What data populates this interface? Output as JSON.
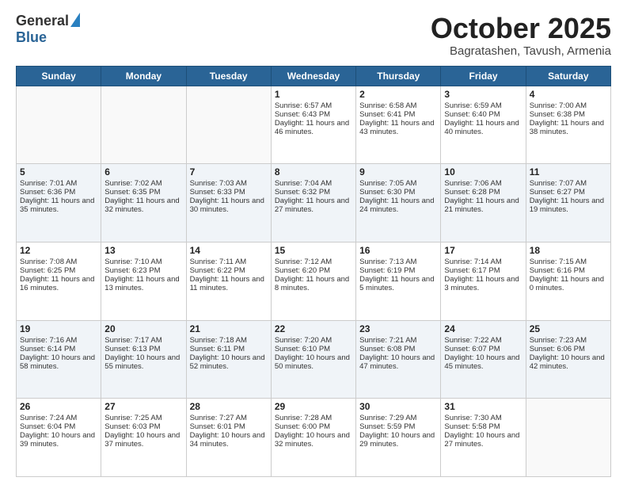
{
  "header": {
    "logo_general": "General",
    "logo_blue": "Blue",
    "month_title": "October 2025",
    "subtitle": "Bagratashen, Tavush, Armenia"
  },
  "days_of_week": [
    "Sunday",
    "Monday",
    "Tuesday",
    "Wednesday",
    "Thursday",
    "Friday",
    "Saturday"
  ],
  "weeks": [
    [
      {
        "day": "",
        "info": ""
      },
      {
        "day": "",
        "info": ""
      },
      {
        "day": "",
        "info": ""
      },
      {
        "day": "1",
        "info": "Sunrise: 6:57 AM\nSunset: 6:43 PM\nDaylight: 11 hours and 46 minutes."
      },
      {
        "day": "2",
        "info": "Sunrise: 6:58 AM\nSunset: 6:41 PM\nDaylight: 11 hours and 43 minutes."
      },
      {
        "day": "3",
        "info": "Sunrise: 6:59 AM\nSunset: 6:40 PM\nDaylight: 11 hours and 40 minutes."
      },
      {
        "day": "4",
        "info": "Sunrise: 7:00 AM\nSunset: 6:38 PM\nDaylight: 11 hours and 38 minutes."
      }
    ],
    [
      {
        "day": "5",
        "info": "Sunrise: 7:01 AM\nSunset: 6:36 PM\nDaylight: 11 hours and 35 minutes."
      },
      {
        "day": "6",
        "info": "Sunrise: 7:02 AM\nSunset: 6:35 PM\nDaylight: 11 hours and 32 minutes."
      },
      {
        "day": "7",
        "info": "Sunrise: 7:03 AM\nSunset: 6:33 PM\nDaylight: 11 hours and 30 minutes."
      },
      {
        "day": "8",
        "info": "Sunrise: 7:04 AM\nSunset: 6:32 PM\nDaylight: 11 hours and 27 minutes."
      },
      {
        "day": "9",
        "info": "Sunrise: 7:05 AM\nSunset: 6:30 PM\nDaylight: 11 hours and 24 minutes."
      },
      {
        "day": "10",
        "info": "Sunrise: 7:06 AM\nSunset: 6:28 PM\nDaylight: 11 hours and 21 minutes."
      },
      {
        "day": "11",
        "info": "Sunrise: 7:07 AM\nSunset: 6:27 PM\nDaylight: 11 hours and 19 minutes."
      }
    ],
    [
      {
        "day": "12",
        "info": "Sunrise: 7:08 AM\nSunset: 6:25 PM\nDaylight: 11 hours and 16 minutes."
      },
      {
        "day": "13",
        "info": "Sunrise: 7:10 AM\nSunset: 6:23 PM\nDaylight: 11 hours and 13 minutes."
      },
      {
        "day": "14",
        "info": "Sunrise: 7:11 AM\nSunset: 6:22 PM\nDaylight: 11 hours and 11 minutes."
      },
      {
        "day": "15",
        "info": "Sunrise: 7:12 AM\nSunset: 6:20 PM\nDaylight: 11 hours and 8 minutes."
      },
      {
        "day": "16",
        "info": "Sunrise: 7:13 AM\nSunset: 6:19 PM\nDaylight: 11 hours and 5 minutes."
      },
      {
        "day": "17",
        "info": "Sunrise: 7:14 AM\nSunset: 6:17 PM\nDaylight: 11 hours and 3 minutes."
      },
      {
        "day": "18",
        "info": "Sunrise: 7:15 AM\nSunset: 6:16 PM\nDaylight: 11 hours and 0 minutes."
      }
    ],
    [
      {
        "day": "19",
        "info": "Sunrise: 7:16 AM\nSunset: 6:14 PM\nDaylight: 10 hours and 58 minutes."
      },
      {
        "day": "20",
        "info": "Sunrise: 7:17 AM\nSunset: 6:13 PM\nDaylight: 10 hours and 55 minutes."
      },
      {
        "day": "21",
        "info": "Sunrise: 7:18 AM\nSunset: 6:11 PM\nDaylight: 10 hours and 52 minutes."
      },
      {
        "day": "22",
        "info": "Sunrise: 7:20 AM\nSunset: 6:10 PM\nDaylight: 10 hours and 50 minutes."
      },
      {
        "day": "23",
        "info": "Sunrise: 7:21 AM\nSunset: 6:08 PM\nDaylight: 10 hours and 47 minutes."
      },
      {
        "day": "24",
        "info": "Sunrise: 7:22 AM\nSunset: 6:07 PM\nDaylight: 10 hours and 45 minutes."
      },
      {
        "day": "25",
        "info": "Sunrise: 7:23 AM\nSunset: 6:06 PM\nDaylight: 10 hours and 42 minutes."
      }
    ],
    [
      {
        "day": "26",
        "info": "Sunrise: 7:24 AM\nSunset: 6:04 PM\nDaylight: 10 hours and 39 minutes."
      },
      {
        "day": "27",
        "info": "Sunrise: 7:25 AM\nSunset: 6:03 PM\nDaylight: 10 hours and 37 minutes."
      },
      {
        "day": "28",
        "info": "Sunrise: 7:27 AM\nSunset: 6:01 PM\nDaylight: 10 hours and 34 minutes."
      },
      {
        "day": "29",
        "info": "Sunrise: 7:28 AM\nSunset: 6:00 PM\nDaylight: 10 hours and 32 minutes."
      },
      {
        "day": "30",
        "info": "Sunrise: 7:29 AM\nSunset: 5:59 PM\nDaylight: 10 hours and 29 minutes."
      },
      {
        "day": "31",
        "info": "Sunrise: 7:30 AM\nSunset: 5:58 PM\nDaylight: 10 hours and 27 minutes."
      },
      {
        "day": "",
        "info": ""
      }
    ]
  ]
}
